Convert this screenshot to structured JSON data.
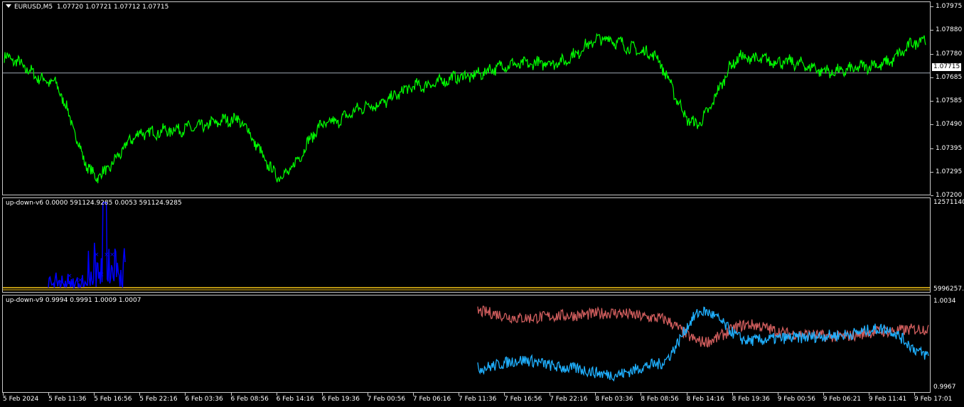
{
  "colors": {
    "background": "#000000",
    "price_line": "#00ff00",
    "current_price_line": "#9ea7b3",
    "ind1_series": "#0000ff",
    "ind1_level": "#f5c518",
    "ind2_series_a": "#cd5c5c",
    "ind2_series_b": "#1fb0ff",
    "border": "#c8c8c8",
    "text": "#ffffff"
  },
  "main_pane": {
    "symbol": "EURUSD,M5",
    "ohlc": "1.07720 1.07721 1.07712 1.07715",
    "price_axis": [
      "1.07975",
      "1.07880",
      "1.07780",
      "1.07685",
      "1.07585",
      "1.07490",
      "1.07395",
      "1.07295",
      "1.07200"
    ],
    "current_price": "1.07715"
  },
  "indicator1": {
    "label": "up-down-v6 0.0000 591124.9285 0.0053 591124.9285",
    "axis_top": "12571140",
    "axis_bottom": "5996257."
  },
  "indicator2": {
    "label": "up-down-v9 0.9994 0.9991 1.0009 1.0007",
    "axis_top": "1.0034",
    "axis_bottom": "0.9967"
  },
  "time_axis": [
    "5 Feb 2024",
    "5 Feb 11:36",
    "5 Feb 16:56",
    "5 Feb 22:16",
    "6 Feb 03:36",
    "6 Feb 08:56",
    "6 Feb 14:16",
    "6 Feb 19:36",
    "7 Feb 00:56",
    "7 Feb 06:16",
    "7 Feb 11:36",
    "7 Feb 16:56",
    "7 Feb 22:16",
    "8 Feb 03:36",
    "8 Feb 08:56",
    "8 Feb 14:16",
    "8 Feb 19:36",
    "9 Feb 00:56",
    "9 Feb 06:21",
    "9 Feb 11:41",
    "9 Feb 17:01"
  ],
  "chart_data": {
    "type": "line",
    "title": "EURUSD,M5",
    "x": [
      "5 Feb 2024",
      "5 Feb 11:36",
      "5 Feb 16:56",
      "5 Feb 22:16",
      "6 Feb 03:36",
      "6 Feb 08:56",
      "6 Feb 14:16",
      "6 Feb 19:36",
      "7 Feb 00:56",
      "7 Feb 06:16",
      "7 Feb 11:36",
      "7 Feb 16:56",
      "7 Feb 22:16",
      "8 Feb 03:36",
      "8 Feb 08:56",
      "8 Feb 14:16",
      "8 Feb 19:36",
      "9 Feb 00:56",
      "9 Feb 06:21",
      "9 Feb 11:41",
      "9 Feb 17:01"
    ],
    "series": [
      {
        "values": [
          1.0778,
          1.0768,
          1.0728,
          1.0746,
          1.0748,
          1.0752,
          1.0728,
          1.075,
          1.0758,
          1.0766,
          1.077,
          1.0775,
          1.0776,
          1.0786,
          1.078,
          1.075,
          1.0778,
          1.0776,
          1.0772,
          1.0775,
          1.0786
        ]
      }
    ],
    "ylim": [
      1.072,
      1.08
    ],
    "indicator_v6": {
      "x": [
        "5 Feb 2024",
        "5 Feb 11:36",
        "5 Feb 16:56",
        "5 Feb 22:16"
      ],
      "values": [
        6100000,
        6800000,
        12571140,
        6000000
      ],
      "level": 5996257
    },
    "indicator_v9": {
      "x": [
        "7 Feb 11:36",
        "7 Feb 16:56",
        "7 Feb 22:16",
        "8 Feb 03:36",
        "8 Feb 08:56",
        "8 Feb 14:16",
        "8 Feb 19:36",
        "9 Feb 00:56",
        "9 Feb 06:21",
        "9 Feb 11:41",
        "9 Feb 17:01"
      ],
      "series": [
        {
          "values": [
            1.0025,
            1.002,
            1.0022,
            1.0024,
            1.002,
            1.0002,
            1.0015,
            1.0008,
            1.0006,
            1.001,
            1.0012
          ]
        },
        {
          "values": [
            0.9982,
            0.9988,
            0.9982,
            0.9977,
            0.9985,
            1.0025,
            1.0003,
            1.0005,
            1.0007,
            1.0012,
            0.9992
          ]
        }
      ],
      "ylim": [
        0.9967,
        1.0034
      ]
    }
  }
}
